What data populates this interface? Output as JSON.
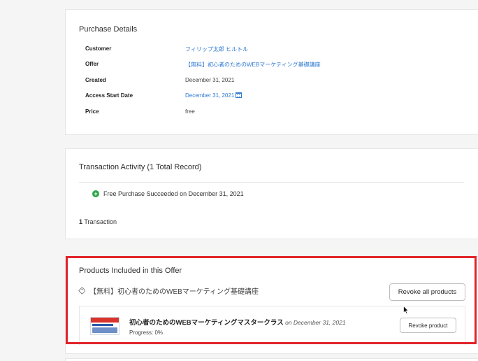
{
  "purchase_details": {
    "title": "Purchase Details",
    "rows": [
      {
        "label": "Customer",
        "value": "フィリップ太郎 ヒルトル"
      },
      {
        "label": "Offer",
        "value": "【無料】初心者のためのWEBマーケティング基礎講座"
      },
      {
        "label": "Created",
        "value": "December 31, 2021"
      },
      {
        "label": "Access Start Date",
        "value": "December 31, 2021"
      },
      {
        "label": "Price",
        "value": "free"
      }
    ]
  },
  "transaction_activity": {
    "title": "Transaction Activity (1 Total Record)",
    "item": "Free Purchase Succeeded on December 31, 2021",
    "count_number": "1",
    "count_label": " Transaction"
  },
  "products": {
    "title": "Products Included in this Offer",
    "offer_tag": "【無料】初心者のためのWEBマーケティング基礎講座",
    "revoke_all_label": "Revoke all products",
    "product": {
      "name": "初心者のためのWEBマーケティングマスタークラス",
      "date": " on December 31, 2021",
      "progress": "Progress: 0%",
      "revoke_label": "Revoke product"
    }
  },
  "colors": {
    "link": "#2f7ad1",
    "success": "#2ca54a",
    "highlight": "#e1242a"
  },
  "icons": [
    "calendar-icon",
    "check-circle-icon",
    "tag-icon",
    "mouse-cursor-icon"
  ]
}
